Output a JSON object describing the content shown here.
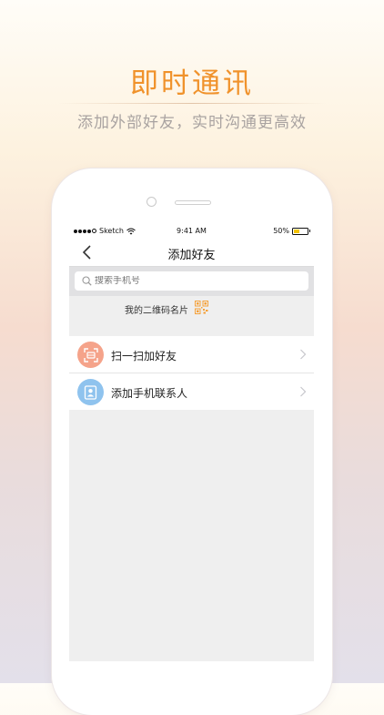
{
  "promo": {
    "title": "即时通讯",
    "subtitle": "添加外部好友，实时沟通更高效"
  },
  "status_bar": {
    "carrier": "Sketch",
    "time": "9:41 AM",
    "battery": "50%",
    "battery_level": 0.5
  },
  "nav": {
    "title": "添加好友",
    "back_icon": "chevron-left-icon"
  },
  "search": {
    "placeholder": "搜索手机号",
    "value": ""
  },
  "qr_card": {
    "label": "我的二维码名片",
    "icon": "qr-code-icon"
  },
  "actions": [
    {
      "label": "扫一扫加好友",
      "icon": "scan-icon",
      "color": "#f5a38a"
    },
    {
      "label": "添加手机联系人",
      "icon": "contacts-icon",
      "color": "#8fc3ee"
    }
  ],
  "colors": {
    "accent": "#f0922b",
    "qr": "#f5a13a"
  }
}
